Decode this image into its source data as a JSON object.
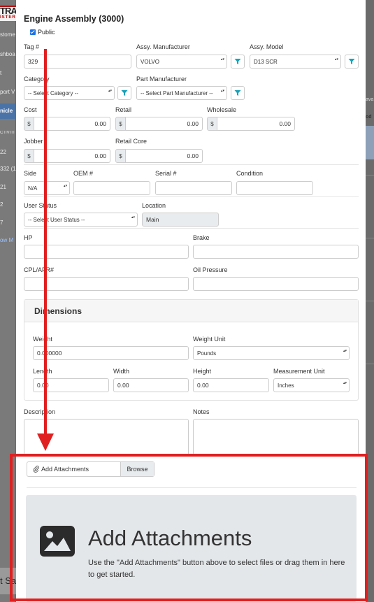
{
  "background": {
    "logo_line1": "TRA",
    "logo_line2": "ISTERI",
    "nav_items": [
      "stome",
      "shboa",
      "t",
      "port V",
      "nicle",
      "CTIVITI",
      "22",
      "332 (1",
      "21",
      "2",
      "7",
      "ow M"
    ],
    "right_texts": [
      "ava",
      "od"
    ],
    "bottom_button": "t Sa"
  },
  "modal": {
    "title": "Engine Assembly (3000)",
    "public_label": "Public",
    "public_checked": true,
    "tag_label": "Tag #",
    "tag_value": "329",
    "assy_manufacturer_label": "Assy. Manufacturer",
    "assy_manufacturer_value": "VOLVO",
    "assy_model_label": "Assy. Model",
    "assy_model_value": "D13 SCR",
    "category_label": "Category",
    "category_value": "-- Select Category --",
    "part_manufacturer_label": "Part Manufacturer",
    "part_manufacturer_value": "-- Select Part Manufacturer --",
    "cost_label": "Cost",
    "cost_value": "0.00",
    "retail_label": "Retail",
    "retail_value": "0.00",
    "wholesale_label": "Wholesale",
    "wholesale_value": "0.00",
    "jobber_label": "Jobber",
    "jobber_value": "0.00",
    "retail_core_label": "Retail Core",
    "retail_core_value": "0.00",
    "currency_symbol": "$",
    "side_label": "Side",
    "side_value": "N/A",
    "oem_label": "OEM #",
    "serial_label": "Serial #",
    "condition_label": "Condition",
    "user_status_label": "User Status",
    "user_status_value": "-- Select User Status --",
    "location_label": "Location",
    "location_value": "Main",
    "hp_label": "HP",
    "brake_label": "Brake",
    "cpl_label": "CPL/AFR#",
    "oil_pressure_label": "Oil Pressure",
    "dimensions": {
      "title": "Dimensions",
      "weight_label": "Weight",
      "weight_value": "0.000000",
      "weight_unit_label": "Weight Unit",
      "weight_unit_value": "Pounds",
      "length_label": "Length",
      "length_value": "0.00",
      "width_label": "Width",
      "width_value": "0.00",
      "height_label": "Height",
      "height_value": "0.00",
      "measurement_unit_label": "Measurement Unit",
      "measurement_unit_value": "Inches"
    },
    "description_label": "Description",
    "notes_label": "Notes",
    "attachments": {
      "file_input_label": "Add Attachments",
      "browse_label": "Browse",
      "drop_title": "Add Attachments",
      "drop_text": "Use the \"Add Attachments\" button above to select files or drag them in here to get started."
    }
  },
  "colors": {
    "annotation_red": "#e02020",
    "filter_teal": "#17a2b8",
    "checkbox_blue": "#1a73e8"
  }
}
